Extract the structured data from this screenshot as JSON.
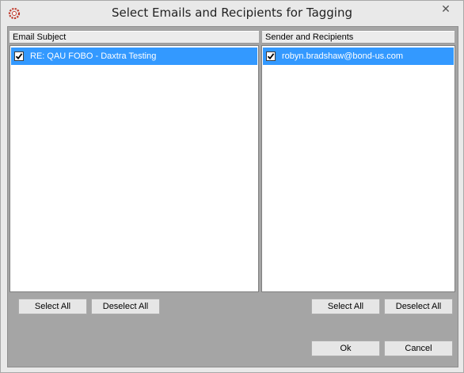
{
  "window": {
    "title": "Select Emails and Recipients for Tagging",
    "close_glyph": "✕"
  },
  "left_panel": {
    "header": "Email Subject",
    "items": [
      {
        "label": "RE: QAU FOBO - Daxtra Testing",
        "checked": true,
        "selected": true
      }
    ],
    "select_all": "Select All",
    "deselect_all": "Deselect All"
  },
  "right_panel": {
    "header": "Sender  and Recipients",
    "items": [
      {
        "label": "robyn.bradshaw@bond-us.com",
        "checked": true,
        "selected": true
      }
    ],
    "select_all": "Select All",
    "deselect_all": "Deselect All"
  },
  "footer": {
    "ok": "Ok",
    "cancel": "Cancel"
  },
  "colors": {
    "selection": "#3399ff",
    "client_bg": "#a5a5a5",
    "app_icon": "#c0392b"
  }
}
